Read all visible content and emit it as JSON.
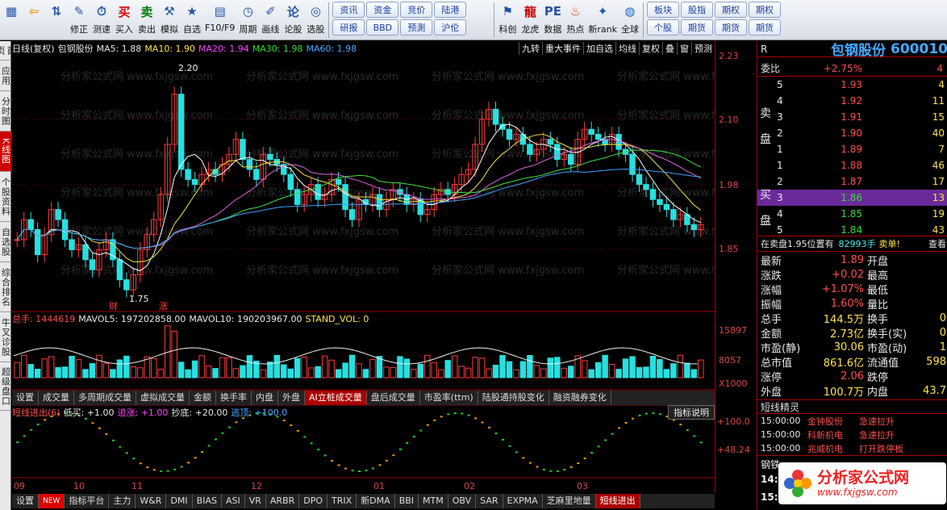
{
  "toolbar": {
    "buttons": [
      {
        "label": "",
        "icon": "grid-icon"
      },
      {
        "label": "",
        "icon": "back-arrow-icon"
      },
      {
        "label": "",
        "icon": "up-down-icon"
      },
      {
        "label": "修正",
        "icon": "fix-icon"
      },
      {
        "label": "测速",
        "icon": "clock-icon"
      },
      {
        "label": "买入",
        "icon": "buy-icon"
      },
      {
        "label": "卖出",
        "icon": "sell-icon"
      },
      {
        "label": "模拟",
        "icon": "hammer-icon"
      },
      {
        "label": "自选",
        "icon": "favorites-icon"
      },
      {
        "label": "F10/F9",
        "icon": "f10-icon"
      },
      {
        "label": "周期",
        "icon": "period-icon"
      },
      {
        "label": "画线",
        "icon": "pen-icon"
      },
      {
        "label": "论股",
        "icon": "discuss-icon"
      },
      {
        "label": "选股",
        "icon": "select-icon"
      }
    ],
    "pills_top": [
      "资讯",
      "资金",
      "竞价",
      "陆港"
    ],
    "pills_bottom": [
      "研报",
      "BBD",
      "预測",
      "沪伦"
    ],
    "buttons2": [
      {
        "label": "科创",
        "icon": "alarm-icon"
      },
      {
        "label": "龙虎",
        "icon": "dragon-icon"
      },
      {
        "label": "数据",
        "icon": "pe-icon"
      },
      {
        "label": "热点",
        "icon": "hot-icon"
      },
      {
        "label": "新rank",
        "icon": "new-icon"
      },
      {
        "label": "全球",
        "icon": "globe-icon"
      }
    ],
    "pills2_top": [
      "板块",
      "股指",
      "期权",
      "期权"
    ],
    "pills2_bottom": [
      "个股",
      "期货",
      "期货",
      "期货"
    ]
  },
  "leftnav": [
    "首页",
    "应用",
    "分时图",
    "K线图",
    "个股资料",
    "自选股",
    "综合排名",
    "牛叉诊股",
    "超级盘口"
  ],
  "chart": {
    "header": {
      "period": "日线(复权)",
      "name": "包钢股份",
      "ma5": "MA5: 1.88",
      "ma10": "MA10: 1.90",
      "ma20": "MA20: 1.94",
      "ma30": "MA30: 1.98",
      "ma60": "MA60: 1.98"
    },
    "header_tabs": [
      "九转",
      "重大事件",
      "加自选",
      "均线",
      "复权",
      "叠",
      "窗",
      "预测"
    ],
    "price_ticks": [
      "2.23",
      "2.10",
      "1.98",
      "1.85"
    ],
    "high_label": "2.20",
    "low_label": "1.75",
    "marker_cai": "财",
    "marker_zhang": "涨",
    "vol_header": {
      "total": "总手: 1444619",
      "mavol5": "MAVOL5: 197202858.00",
      "mavol10": "MAVOL10: 190203967.00",
      "stand": "STAND_VOL: 0"
    },
    "vol_ticks": [
      "15897",
      "8057",
      "X1000"
    ],
    "mid_tabs": [
      "设置",
      "成交量",
      "多周期成交量",
      "虚拟成交量",
      "金额",
      "换手率",
      "内盘",
      "外盘",
      "AI立桩成交量",
      "盘后成交量",
      "市盈率(ttm)",
      "陆股通持股变化",
      "融资融券变化"
    ],
    "ind_header": {
      "name": "短线进出(6)",
      "low": "低买: +1.00",
      "chase": "追涨: +1.00",
      "bottom": "抄底: +20.00",
      "escape": "逃顶: +100.0"
    },
    "ind_button": "指标说明",
    "ind_ticks": [
      "+100.0",
      "+48.24"
    ],
    "months": [
      "09",
      "10",
      "11",
      "12",
      "01",
      "02",
      "03"
    ],
    "bottom_tabs": [
      "设置",
      "NEW",
      "指标平台",
      "主力",
      "W&R",
      "DMI",
      "BIAS",
      "ASI",
      "VR",
      "ARBR",
      "DPO",
      "TRIX",
      "新DMA",
      "BBI",
      "MTM",
      "OBV",
      "SAR",
      "EXPMA",
      "芝麻里地量",
      "短线进出"
    ],
    "watermark": "分析家公式网 www.fxjgsw.com"
  },
  "quote": {
    "title": "包钢股份",
    "code": "600010",
    "R": "R",
    "weibi_label": "委比",
    "weibi": "+2.75%",
    "weicha": "4",
    "sell": [
      [
        "5",
        "1.93",
        "4"
      ],
      [
        "4",
        "1.92",
        "11"
      ],
      [
        "3",
        "1.91",
        "15"
      ],
      [
        "2",
        "1.90",
        "40"
      ],
      [
        "1",
        "1.89",
        "7"
      ]
    ],
    "buy": [
      [
        "1",
        "1.88",
        "46"
      ],
      [
        "2",
        "1.87",
        "17"
      ],
      [
        "3",
        "1.86",
        "13"
      ],
      [
        "4",
        "1.85",
        "19"
      ],
      [
        "5",
        "1.84",
        "43"
      ]
    ],
    "sell_label": "卖盘",
    "buy_label": "买盘",
    "note": "在卖盘1.95位置有",
    "note_vol": "82993手",
    "note_tail": "卖单!",
    "note_link": "查看",
    "stats": [
      [
        "最新",
        "1.89",
        "开盘",
        ""
      ],
      [
        "涨跌",
        "+0.02",
        "最高",
        ""
      ],
      [
        "涨幅",
        "+1.07%",
        "最低",
        ""
      ],
      [
        "振幅",
        "1.60%",
        "量比",
        ""
      ],
      [
        "总手",
        "144.5万",
        "换手",
        "0"
      ],
      [
        "金额",
        "2.73亿",
        "换手(实)",
        "0"
      ],
      [
        "市盈(静)",
        "30.06",
        "市盈(动)",
        "1"
      ],
      [
        "总市值",
        "861.6亿",
        "流通值",
        "598"
      ],
      [
        "涨停",
        "2.06",
        "跌停",
        ""
      ],
      [
        "外盘",
        "100.7万",
        "内盘",
        "43.7"
      ]
    ],
    "elf_title": "短线精灵",
    "elf": [
      [
        "15:00:00",
        "金钟股份",
        "急速拉升"
      ],
      [
        "15:00:00",
        "科新机电",
        "急速拉升"
      ],
      [
        "15:00:00",
        "兆威机电",
        "打开跌停板"
      ]
    ],
    "bottom_stock": "钢铁",
    "bottom_time1": "14:",
    "bottom_time2": "15:",
    "logo_text": "分析家公式网",
    "logo_url": "www.fxjgsw.com"
  },
  "colors": {
    "up": "#ff3b3b",
    "down": "#27e0e0",
    "ma5": "#ffffff",
    "ma10": "#f0e040",
    "ma20": "#e060e0",
    "ma30": "#40e040",
    "ma60": "#40a0ff",
    "grid": "#a00000"
  }
}
